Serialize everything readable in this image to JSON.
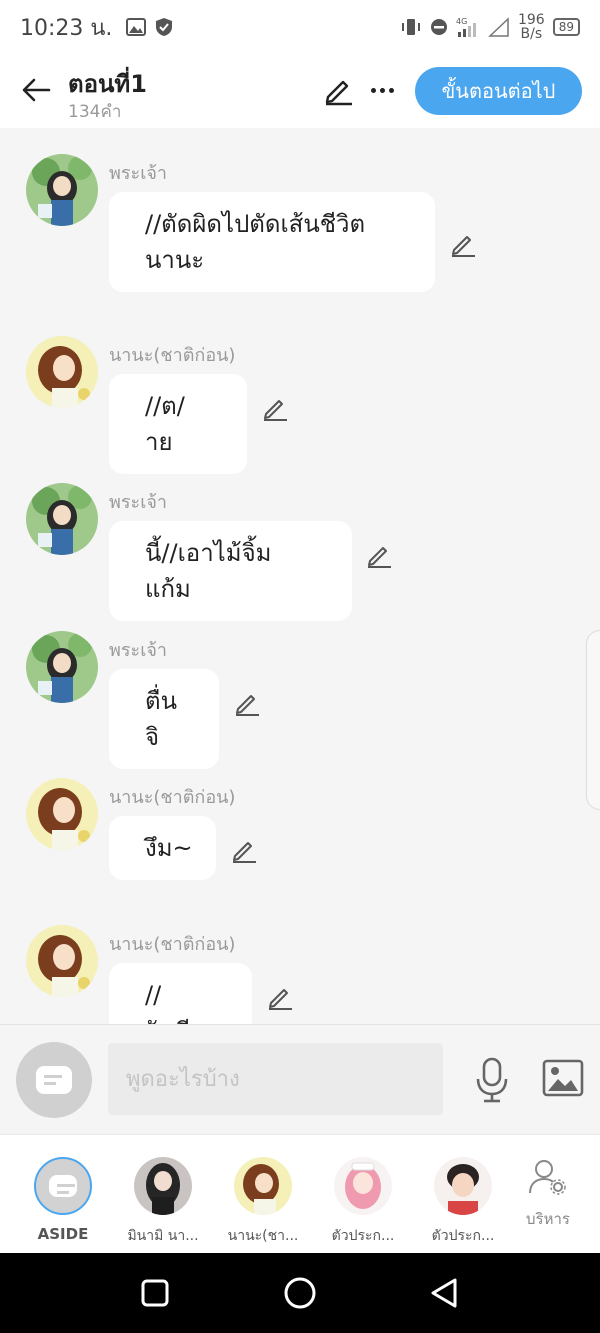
{
  "status_bar": {
    "time": "10:23 น.",
    "net_speed_value": "196",
    "net_speed_unit": "B/s",
    "battery": "89"
  },
  "header": {
    "title": "ตอนที่1",
    "word_count": "134คำ",
    "next_label": "ขั้นตอนต่อไป"
  },
  "messages": [
    {
      "speaker": "พระเจ้า",
      "text_lines": [
        "//ตัดผิดไปตัดเส้นชีวิต",
        "นานะ"
      ],
      "avatar": "god-avatar"
    },
    {
      "speaker": "นานะ(ชาติก่อน)",
      "text_lines": [
        "//ต/าย"
      ],
      "avatar": "nana-avatar"
    },
    {
      "speaker": "พระเจ้า",
      "text_lines": [
        "นี้//เอาไม้จิ้มแก้ม"
      ],
      "avatar": "god-avatar"
    },
    {
      "speaker": "พระเจ้า",
      "text_lines": [
        "ตื่นจิ"
      ],
      "avatar": "god-avatar"
    },
    {
      "speaker": "นานะ(ชาติก่อน)",
      "text_lines": [
        "งึม~"
      ],
      "avatar": "nana-avatar"
    },
    {
      "speaker": "นานะ(ชาติก่อน)",
      "text_lines": [
        "//งัวเงีย"
      ],
      "avatar": "nana-avatar"
    }
  ],
  "composer": {
    "placeholder": "พูดอะไรบ้าง"
  },
  "characters": [
    {
      "label": "ASIDE",
      "icon": "aside-chat-icon"
    },
    {
      "label": "มินามิ นา...",
      "icon": "minami-avatar"
    },
    {
      "label": "นานะ(ชา...",
      "icon": "nana-avatar"
    },
    {
      "label": "ตัวประก...",
      "icon": "pink-hair-avatar"
    },
    {
      "label": "ตัวประก...",
      "icon": "boy-avatar"
    },
    {
      "label": "บริหาร",
      "icon": "manage-user-gear-icon"
    }
  ],
  "colors": {
    "accent": "#4ba6f0",
    "background": "#f5f5f5",
    "bubble": "#ffffff"
  }
}
